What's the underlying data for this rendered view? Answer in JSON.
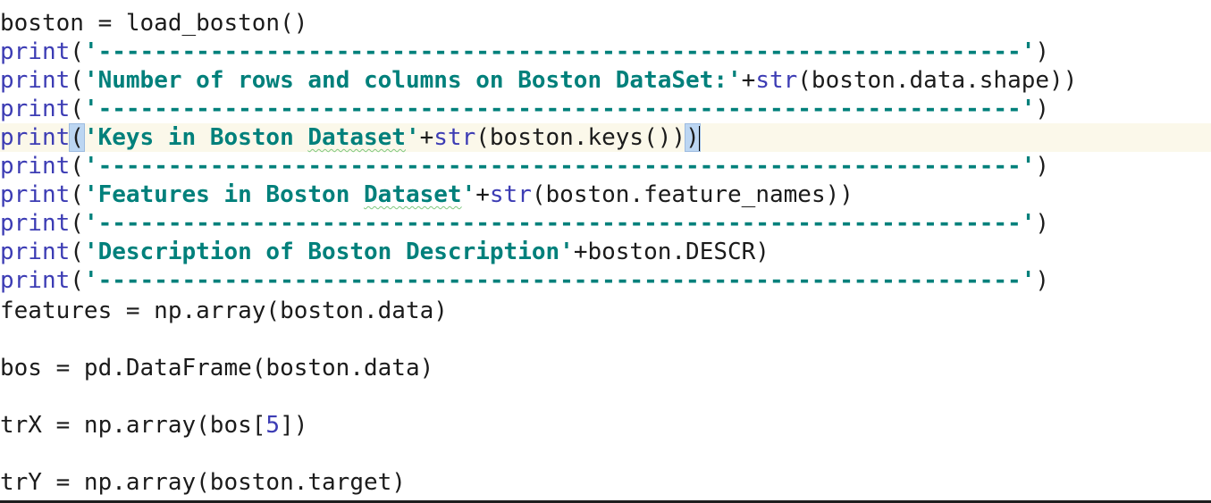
{
  "colors": {
    "function": "#3c3cb4",
    "string": "#00807b",
    "number": "#3c3cb4",
    "text": "#1b1b1b",
    "current_line_bg": "#fbf8ea",
    "bracket_highlight": "#bcd6f2",
    "spellcheck_underline": "#7ec87e"
  },
  "code": {
    "l1": {
      "text": "boston = load_boston()"
    },
    "l2": {
      "fn": "print",
      "open": "(",
      "str": "'------------------------------------------------------------------'",
      "close": ")"
    },
    "l3": {
      "fn": "print",
      "open": "(",
      "str": "'Number of rows and columns on Boston DataSet:'",
      "plus": "+",
      "fn2": "str",
      "rest": "(boston.data.shape))"
    },
    "l4": {
      "fn": "print",
      "open": "(",
      "str": "'------------------------------------------------------------------'",
      "close": ")"
    },
    "l5": {
      "fn": "print",
      "open": "(",
      "str_a": "'Keys in Boston ",
      "str_b": "Dataset",
      "str_c": "'",
      "plus": "+",
      "fn2": "str",
      "rest": "(boston.keys())",
      "close": ")"
    },
    "l6": {
      "fn": "print",
      "open": "(",
      "str": "'------------------------------------------------------------------'",
      "close": ")"
    },
    "l7": {
      "fn": "print",
      "open": "(",
      "str_a": "'Features in Boston ",
      "str_b": "Dataset",
      "str_c": "'",
      "plus": "+",
      "fn2": "str",
      "rest": "(boston.feature_names))"
    },
    "l8": {
      "fn": "print",
      "open": "(",
      "str": "'------------------------------------------------------------------'",
      "close": ")"
    },
    "l9": {
      "fn": "print",
      "open": "(",
      "str": "'Description of Boston Description'",
      "rest": "+boston.DESCR)"
    },
    "l10": {
      "fn": "print",
      "open": "(",
      "str": "'------------------------------------------------------------------'",
      "close": ")"
    },
    "l11": {
      "text": "features = np.array(boston.data)"
    },
    "l12": {
      "text": "bos = pd.DataFrame(boston.data)"
    },
    "l13": {
      "pre": "trX = np.array(bos[",
      "num": "5",
      "post": "])"
    },
    "l14": {
      "text": "trY = np.array(boston.target)"
    }
  }
}
